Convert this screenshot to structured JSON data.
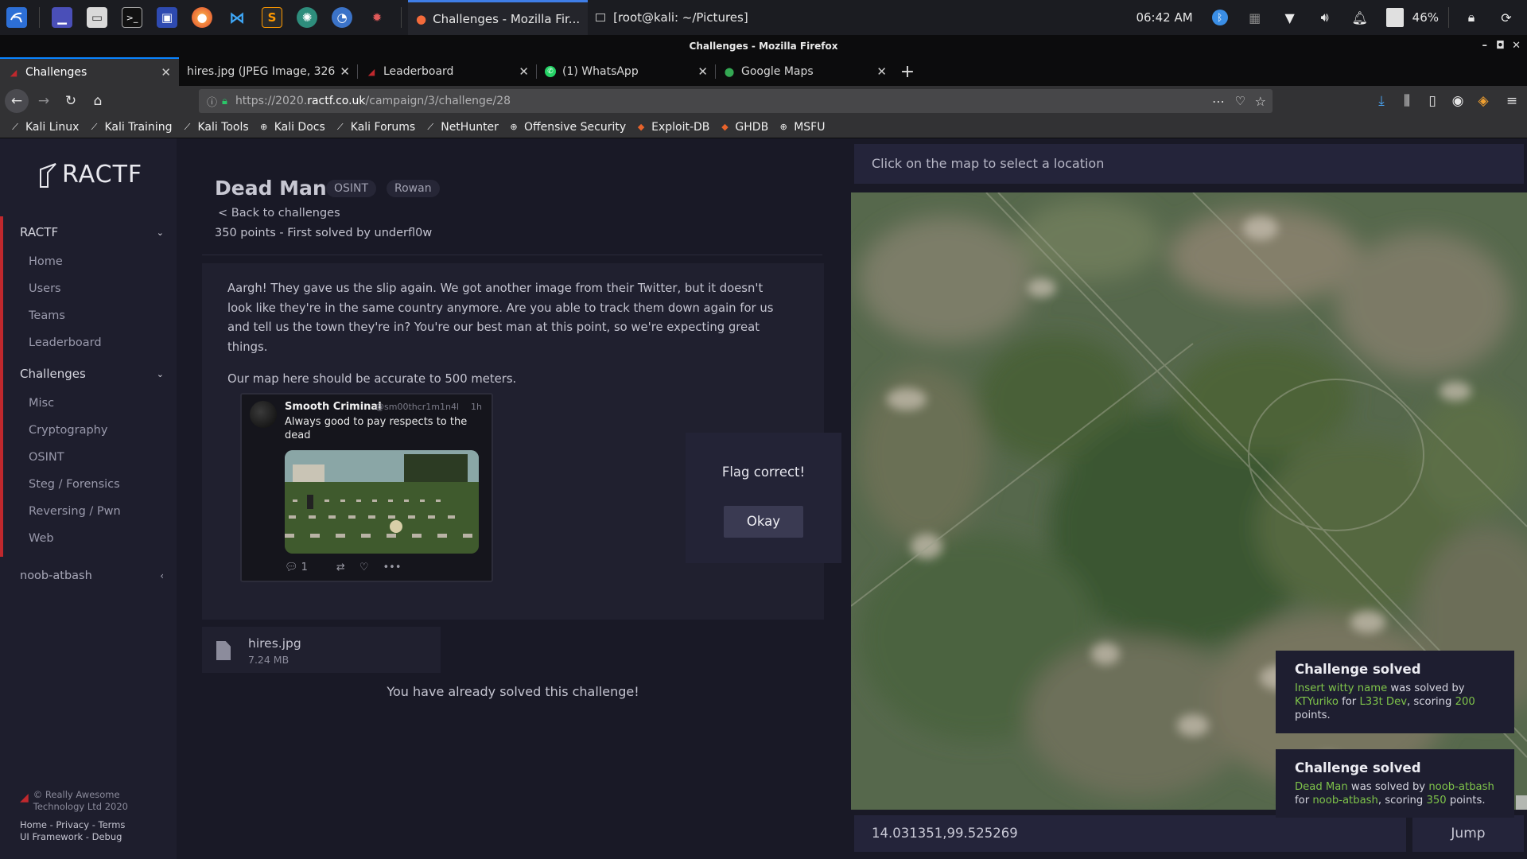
{
  "taskbar": {
    "tasks": [
      "Challenges - Mozilla Fir...",
      "[root@kali: ~/Pictures]"
    ],
    "clock": "06:42 AM",
    "battery": "46%"
  },
  "browser": {
    "window_title": "Challenges - Mozilla Firefox",
    "tabs": [
      {
        "label": "Challenges"
      },
      {
        "label": "hires.jpg (JPEG Image, 3264"
      },
      {
        "label": "Leaderboard"
      },
      {
        "label": "(1) WhatsApp"
      },
      {
        "label": "Google Maps"
      }
    ],
    "url_prefix": "https://2020.",
    "url_domain": "ractf.co.uk",
    "url_path": "/campaign/3/challenge/28",
    "bookmarks": [
      "Kali Linux",
      "Kali Training",
      "Kali Tools",
      "Kali Docs",
      "Kali Forums",
      "NetHunter",
      "Offensive Security",
      "Exploit-DB",
      "GHDB",
      "MSFU"
    ]
  },
  "sidebar": {
    "logo": "RACTF",
    "group1": {
      "title": "RACTF",
      "items": [
        "Home",
        "Users",
        "Teams",
        "Leaderboard"
      ]
    },
    "group2": {
      "title": "Challenges",
      "items": [
        "Misc",
        "Cryptography",
        "OSINT",
        "Steg / Forensics",
        "Reversing / Pwn",
        "Web"
      ]
    },
    "user": "noob-atbash",
    "footer": {
      "copyright_1": "© Really Awesome",
      "copyright_2": "Technology Ltd 2020",
      "links_1": "Home - Privacy - Terms",
      "links_2": "UI Framework - Debug"
    }
  },
  "challenge": {
    "title": "Dead Man",
    "tags": [
      "OSINT",
      "Rowan"
    ],
    "back": "< Back to challenges",
    "points": "350 points - First solved by underfl0w",
    "description_p1": "Aargh! They gave us the slip again. We got another image from their Twitter, but it doesn't look like they're in the same country anymore. Are you able to track them down again for us and tell us the town they're in? You're our best man at this point, so we're expecting great things.",
    "description_p2": "Our map here should be accurate to 500 meters.",
    "tweet": {
      "name": "Smooth Criminal",
      "handle": "@sm00thcr1m1n4l",
      "time": "1h",
      "text": "Always good to pay respects to the dead",
      "replies": "1"
    },
    "file_name": "hires.jpg",
    "file_size": "7.24 MB",
    "solved_message": "You have already solved this challenge!"
  },
  "modal": {
    "message": "Flag correct!",
    "button": "Okay"
  },
  "map": {
    "header": "Click on the map to select a location",
    "coordinates": "14.031351,99.525269",
    "jump_label": "Jump"
  },
  "toasts": [
    {
      "title": "Challenge solved",
      "part1": "Insert witty name",
      "part2": " was solved by ",
      "part3": "KTYuriko",
      "part4": " for ",
      "part5": "L33t Dev",
      "part6": ", scoring ",
      "part7": "200",
      "part8": " points."
    },
    {
      "title": "Challenge solved",
      "part1": "Dead Man",
      "part2": " was solved by ",
      "part3": "noob-atbash",
      "part4": " for ",
      "part5": "noob-atbash",
      "part6": ", scoring ",
      "part7": "350",
      "part8": " points."
    }
  ],
  "colors": {
    "accent_red": "#c0282d",
    "toast_highlight": "#7ec34a",
    "firefox_blue": "#0a84ff"
  }
}
